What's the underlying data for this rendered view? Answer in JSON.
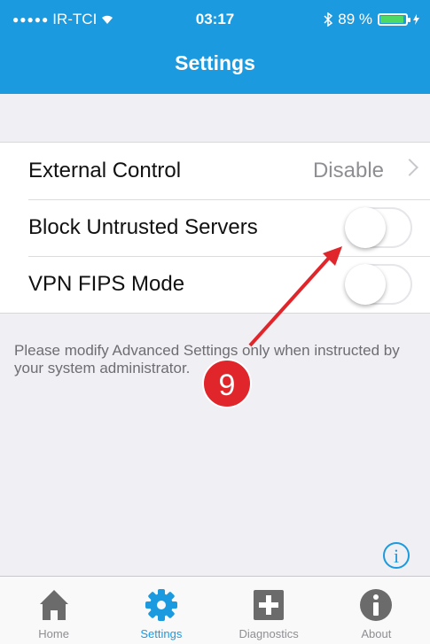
{
  "status_bar": {
    "carrier": "IR-TCI",
    "time": "03:17",
    "battery": "89 %",
    "battery_level": 0.89
  },
  "header": {
    "title": "Settings"
  },
  "settings": {
    "rows": [
      {
        "label": "External Control",
        "value": "Disable"
      },
      {
        "label": "Block Untrusted Servers",
        "toggle_on": false
      },
      {
        "label": "VPN FIPS Mode",
        "toggle_on": false
      }
    ],
    "note": "Please modify Advanced Settings only when instructed by your system administrator."
  },
  "annotation": {
    "number": "9",
    "color": "#e0252b"
  },
  "tabs": [
    {
      "label": "Home",
      "icon": "home-icon",
      "active": false
    },
    {
      "label": "Settings",
      "icon": "gear-icon",
      "active": true
    },
    {
      "label": "Diagnostics",
      "icon": "plus-square-icon",
      "active": false
    },
    {
      "label": "About",
      "icon": "info-circle-icon",
      "active": false
    }
  ],
  "colors": {
    "accent": "#1b9ae0",
    "background": "#efeff4"
  }
}
